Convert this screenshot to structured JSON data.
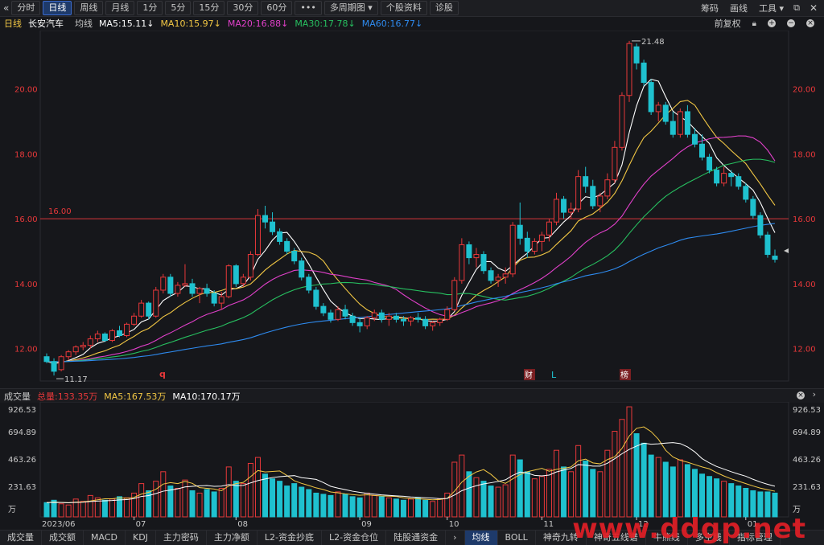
{
  "toolbar": {
    "collapse_icon": "double-chevron-left-icon",
    "periods": [
      "分时",
      "日线",
      "周线",
      "月线",
      "1分",
      "5分",
      "15分",
      "30分",
      "60分",
      "•••",
      "多周期图",
      "个股资料",
      "诊股"
    ],
    "active_period": "日线",
    "multi_dropdown_icon": "chevron-down-icon",
    "right_links": [
      "筹码",
      "画线",
      "工具"
    ],
    "tools_dropdown_icon": "chevron-down-icon",
    "restore_icon": "restore-icon",
    "close_icon": "close-icon"
  },
  "info": {
    "period": "日线",
    "stock": "长安汽车",
    "ma_label": "均线",
    "ma": [
      {
        "label": "MA5:15.11",
        "color": "#ffffff"
      },
      {
        "label": "MA10:15.97",
        "color": "#f2c744"
      },
      {
        "label": "MA20:16.88",
        "color": "#e040c9"
      },
      {
        "label": "MA30:17.78",
        "color": "#27c060"
      },
      {
        "label": "MA60:16.77",
        "color": "#2e8bf0"
      }
    ],
    "restore_label": "前复权",
    "lock_icon": "lock-icon",
    "zoom_in_icon": "zoom-in-icon",
    "zoom_out_icon": "zoom-out-icon",
    "close_icon": "close-icon"
  },
  "price_axis": {
    "ticks": [
      "20.00",
      "18.00",
      "16.00",
      "14.00",
      "12.00"
    ],
    "color": "#e8383a"
  },
  "annotations": {
    "high": "21.48",
    "low": "11.17",
    "hline": "16.00",
    "marker_q": "q",
    "marker_cai": "财",
    "marker_L": "L",
    "marker_bang": "榜"
  },
  "volume": {
    "label": "成交量",
    "total": "总量:133.35万",
    "ma5": "MA5:167.53万",
    "ma10": "MA10:170.17万",
    "axis": [
      "926.53",
      "694.89",
      "463.26",
      "231.63",
      "万"
    ],
    "months": [
      "2023/06",
      "07",
      "08",
      "09",
      "10",
      "11",
      "12",
      "01"
    ],
    "close_icon": "close-icon",
    "expand_icon": "expand-icon"
  },
  "bottom_tabs": [
    "成交量",
    "成交额",
    "MACD",
    "KDJ",
    "主力密码",
    "主力净额",
    "L2-资金抄底",
    "L2-资金仓位",
    "陆股通资金",
    "均线",
    "BOLL",
    "神奇九转",
    "神奇五线谱",
    "牛熊线",
    "多空线",
    "指标管理"
  ],
  "bottom_active": "均线",
  "watermark": "www.ddgp.net",
  "colors": {
    "up": "#e8383a",
    "down": "#1fc1cf",
    "bg": "#16171b"
  },
  "chart_data": {
    "type": "candlestick",
    "price_range": [
      11.0,
      21.8
    ],
    "hline": 16.0,
    "candles": [
      [
        11.75,
        11.85,
        11.55,
        11.6
      ],
      [
        11.6,
        11.7,
        11.17,
        11.3
      ],
      [
        11.35,
        11.8,
        11.3,
        11.75
      ],
      [
        11.75,
        11.95,
        11.65,
        11.9
      ],
      [
        11.9,
        12.1,
        11.8,
        12.05
      ],
      [
        12.05,
        12.2,
        11.95,
        12.1
      ],
      [
        12.1,
        12.4,
        12.0,
        12.3
      ],
      [
        12.3,
        12.55,
        12.2,
        12.45
      ],
      [
        12.45,
        12.5,
        12.2,
        12.25
      ],
      [
        12.25,
        12.6,
        12.2,
        12.55
      ],
      [
        12.55,
        12.7,
        12.35,
        12.4
      ],
      [
        12.4,
        12.8,
        12.35,
        12.75
      ],
      [
        12.75,
        13.1,
        12.7,
        13.0
      ],
      [
        13.0,
        13.5,
        12.95,
        13.4
      ],
      [
        13.4,
        13.45,
        12.9,
        13.0
      ],
      [
        13.0,
        13.9,
        12.95,
        13.8
      ],
      [
        13.8,
        14.3,
        13.7,
        14.2
      ],
      [
        14.2,
        14.3,
        13.6,
        13.7
      ],
      [
        13.7,
        14.05,
        13.6,
        13.95
      ],
      [
        13.95,
        14.6,
        13.9,
        14.0
      ],
      [
        14.0,
        14.15,
        13.6,
        13.7
      ],
      [
        13.7,
        13.9,
        13.4,
        13.85
      ],
      [
        13.85,
        14.0,
        13.6,
        13.7
      ],
      [
        13.7,
        13.8,
        13.3,
        13.4
      ],
      [
        13.4,
        13.75,
        13.2,
        13.6
      ],
      [
        13.6,
        14.6,
        13.55,
        14.55
      ],
      [
        14.55,
        14.6,
        13.9,
        14.0
      ],
      [
        14.0,
        14.3,
        13.9,
        14.2
      ],
      [
        14.2,
        15.0,
        14.1,
        14.9
      ],
      [
        14.9,
        16.3,
        14.85,
        16.1
      ],
      [
        16.1,
        16.4,
        15.7,
        15.9
      ],
      [
        15.9,
        16.2,
        15.5,
        15.6
      ],
      [
        15.6,
        15.7,
        15.2,
        15.3
      ],
      [
        15.3,
        15.4,
        14.9,
        15.0
      ],
      [
        15.0,
        15.1,
        14.6,
        14.7
      ],
      [
        14.7,
        14.8,
        14.1,
        14.2
      ],
      [
        14.2,
        14.3,
        13.7,
        13.8
      ],
      [
        13.8,
        13.9,
        13.2,
        13.3
      ],
      [
        13.3,
        13.4,
        13.0,
        13.1
      ],
      [
        13.1,
        13.2,
        12.8,
        12.9
      ],
      [
        12.9,
        13.3,
        12.85,
        13.2
      ],
      [
        13.2,
        13.35,
        12.9,
        13.0
      ],
      [
        13.0,
        13.1,
        12.7,
        12.8
      ],
      [
        12.8,
        12.95,
        12.5,
        12.7
      ],
      [
        12.7,
        13.0,
        12.6,
        12.95
      ],
      [
        12.95,
        13.2,
        12.85,
        13.1
      ],
      [
        13.1,
        13.2,
        12.8,
        12.9
      ],
      [
        12.9,
        13.1,
        12.7,
        13.0
      ],
      [
        13.0,
        13.1,
        12.8,
        12.9
      ],
      [
        12.9,
        13.0,
        12.7,
        12.85
      ],
      [
        12.85,
        13.0,
        12.7,
        12.95
      ],
      [
        12.95,
        13.1,
        12.8,
        12.9
      ],
      [
        12.9,
        13.0,
        12.6,
        12.7
      ],
      [
        12.7,
        12.85,
        12.55,
        12.8
      ],
      [
        12.8,
        12.95,
        12.7,
        12.9
      ],
      [
        12.9,
        13.3,
        12.85,
        13.2
      ],
      [
        13.2,
        14.2,
        13.15,
        14.1
      ],
      [
        14.1,
        15.4,
        14.0,
        15.2
      ],
      [
        15.2,
        15.3,
        14.6,
        14.8
      ],
      [
        14.8,
        15.1,
        14.5,
        14.9
      ],
      [
        14.9,
        15.0,
        14.3,
        14.4
      ],
      [
        14.4,
        14.5,
        14.0,
        14.1
      ],
      [
        14.1,
        14.3,
        13.9,
        14.2
      ],
      [
        14.2,
        14.5,
        14.0,
        14.3
      ],
      [
        14.3,
        15.9,
        14.2,
        15.8
      ],
      [
        15.8,
        16.5,
        15.2,
        15.4
      ],
      [
        15.4,
        15.6,
        14.8,
        15.0
      ],
      [
        15.0,
        15.4,
        14.9,
        15.3
      ],
      [
        15.3,
        15.6,
        15.0,
        15.5
      ],
      [
        15.5,
        16.0,
        15.3,
        15.9
      ],
      [
        15.9,
        16.8,
        15.8,
        16.6
      ],
      [
        16.6,
        16.7,
        16.0,
        16.2
      ],
      [
        16.2,
        16.5,
        16.0,
        16.3
      ],
      [
        16.3,
        17.5,
        16.2,
        17.3
      ],
      [
        17.3,
        17.6,
        16.8,
        17.0
      ],
      [
        17.0,
        17.2,
        16.3,
        16.4
      ],
      [
        16.4,
        16.8,
        16.2,
        16.7
      ],
      [
        16.7,
        17.4,
        16.6,
        17.2
      ],
      [
        17.2,
        18.4,
        17.1,
        18.2
      ],
      [
        18.2,
        19.9,
        18.1,
        19.8
      ],
      [
        19.8,
        21.48,
        19.6,
        21.4
      ],
      [
        21.3,
        21.4,
        20.6,
        20.8
      ],
      [
        20.8,
        20.9,
        20.1,
        20.2
      ],
      [
        20.2,
        20.3,
        19.2,
        19.3
      ],
      [
        19.3,
        19.6,
        19.0,
        19.5
      ],
      [
        19.5,
        19.6,
        18.9,
        19.0
      ],
      [
        19.0,
        19.3,
        18.5,
        18.6
      ],
      [
        18.6,
        19.4,
        18.5,
        19.3
      ],
      [
        19.3,
        19.5,
        18.5,
        18.6
      ],
      [
        18.6,
        18.8,
        18.2,
        18.3
      ],
      [
        18.3,
        18.6,
        17.8,
        17.9
      ],
      [
        17.9,
        18.0,
        17.4,
        17.5
      ],
      [
        17.5,
        17.6,
        17.0,
        17.1
      ],
      [
        17.1,
        17.6,
        17.0,
        17.4
      ],
      [
        17.4,
        17.5,
        17.0,
        17.3
      ],
      [
        17.3,
        17.4,
        16.9,
        17.0
      ],
      [
        17.0,
        17.1,
        16.5,
        16.6
      ],
      [
        16.6,
        16.7,
        16.0,
        16.1
      ],
      [
        16.1,
        16.2,
        15.4,
        15.5
      ],
      [
        15.5,
        15.6,
        14.8,
        14.9
      ],
      [
        14.85,
        15.05,
        14.65,
        14.75
      ]
    ],
    "volumes": [
      120,
      140,
      110,
      100,
      150,
      130,
      180,
      160,
      140,
      150,
      170,
      160,
      200,
      280,
      220,
      300,
      380,
      260,
      240,
      310,
      220,
      200,
      230,
      210,
      240,
      420,
      300,
      280,
      450,
      500,
      360,
      320,
      300,
      260,
      280,
      250,
      230,
      200,
      190,
      180,
      210,
      190,
      170,
      160,
      200,
      180,
      170,
      160,
      150,
      140,
      150,
      160,
      140,
      130,
      150,
      200,
      460,
      520,
      380,
      330,
      300,
      260,
      250,
      270,
      520,
      480,
      380,
      320,
      340,
      400,
      560,
      420,
      380,
      600,
      470,
      400,
      380,
      560,
      720,
      820,
      926,
      700,
      620,
      520,
      500,
      460,
      420,
      480,
      440,
      400,
      360,
      340,
      320,
      300,
      280,
      260,
      240,
      220,
      210,
      210,
      200
    ]
  }
}
